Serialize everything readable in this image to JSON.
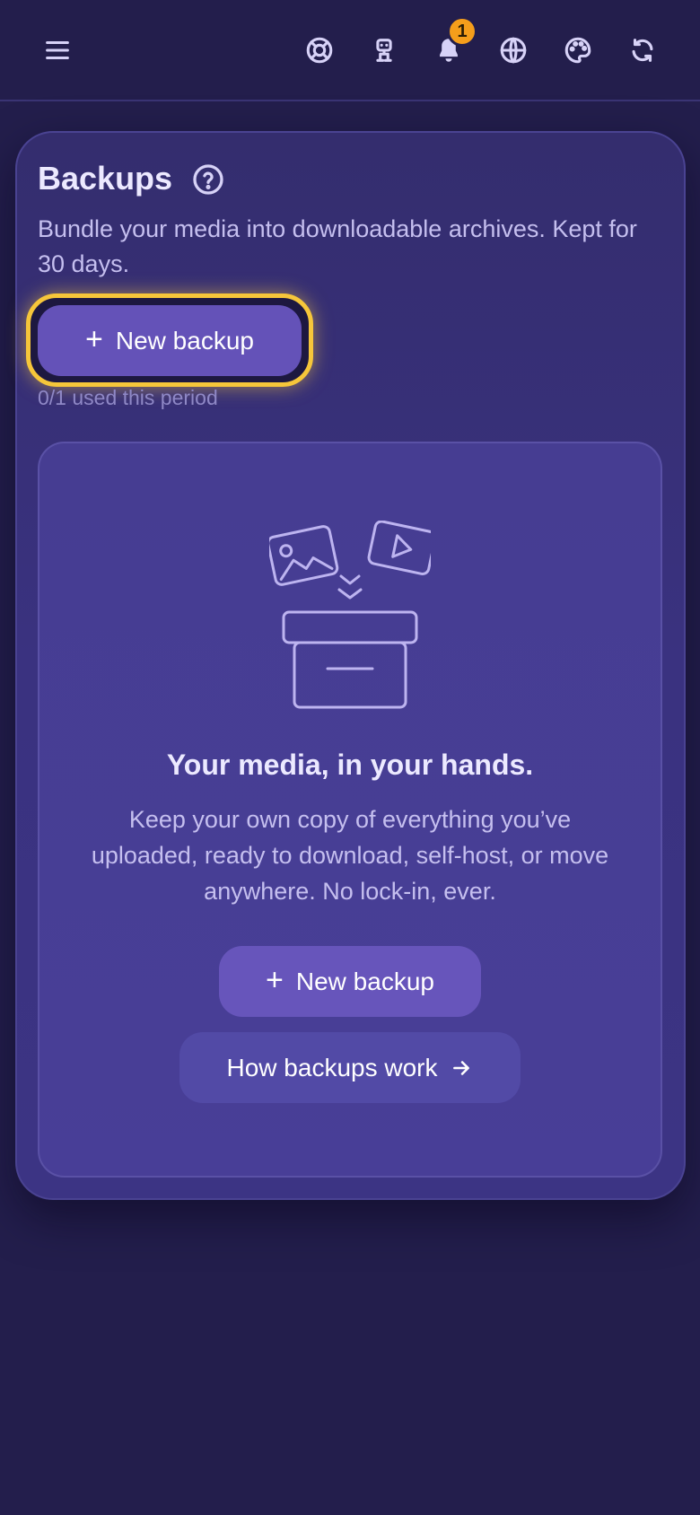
{
  "topbar": {
    "menu_icon": "menu-icon",
    "icons": [
      "support-icon",
      "robot-icon",
      "bell-icon",
      "globe-icon",
      "palette-icon",
      "refresh-icon"
    ],
    "notification_count": "1"
  },
  "backups": {
    "title": "Backups",
    "subtitle": "Bundle your media into downloadable archives. Kept for 30 days.",
    "new_backup_label": "New backup",
    "usage": "0/1 used this period"
  },
  "empty_state": {
    "title": "Your media, in your hands.",
    "description": "Keep your own copy of everything you’ve uploaded, ready to download, self-host, or move anywhere. No lock-in, ever.",
    "new_backup_label": "New backup",
    "how_label": "How backups work"
  },
  "colors": {
    "background": "#231e4c",
    "accent": "#6452b8",
    "focus_ring": "#f6c63a",
    "badge": "#f59e1b"
  }
}
